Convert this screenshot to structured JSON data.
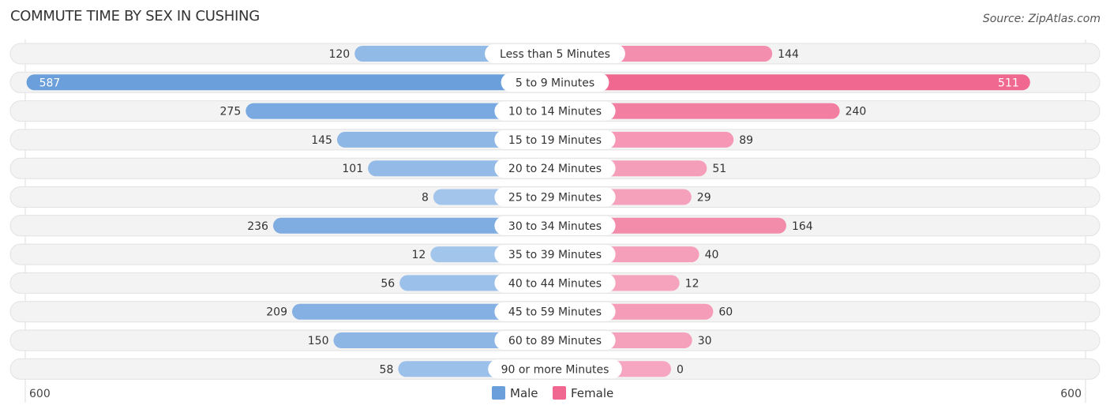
{
  "header": {
    "title": "COMMUTE TIME BY SEX IN CUSHING",
    "source": "Source: ZipAtlas.com"
  },
  "colors": {
    "male": "#6a9fdb",
    "male_light": "#a4c6ec",
    "female": "#f06890",
    "female_light": "#f6a6c0",
    "row_bg": "#f3f3f3"
  },
  "chart_data": {
    "type": "bar",
    "orientation": "horizontal-diverging",
    "title": "COMMUTE TIME BY SEX IN CUSHING",
    "categories": [
      "Less than 5 Minutes",
      "5 to 9 Minutes",
      "10 to 14 Minutes",
      "15 to 19 Minutes",
      "20 to 24 Minutes",
      "25 to 29 Minutes",
      "30 to 34 Minutes",
      "35 to 39 Minutes",
      "40 to 44 Minutes",
      "45 to 59 Minutes",
      "60 to 89 Minutes",
      "90 or more Minutes"
    ],
    "series": [
      {
        "name": "Male",
        "side": "left",
        "values": [
          120,
          587,
          275,
          145,
          101,
          8,
          236,
          12,
          56,
          209,
          150,
          58
        ]
      },
      {
        "name": "Female",
        "side": "right",
        "values": [
          144,
          511,
          240,
          89,
          51,
          29,
          164,
          40,
          12,
          60,
          30,
          0
        ]
      }
    ],
    "axis": {
      "left_label": "600",
      "right_label": "600",
      "range": [
        0,
        600
      ]
    },
    "legend": {
      "position": "bottom-center",
      "items": [
        "Male",
        "Female"
      ]
    },
    "grid": false
  }
}
